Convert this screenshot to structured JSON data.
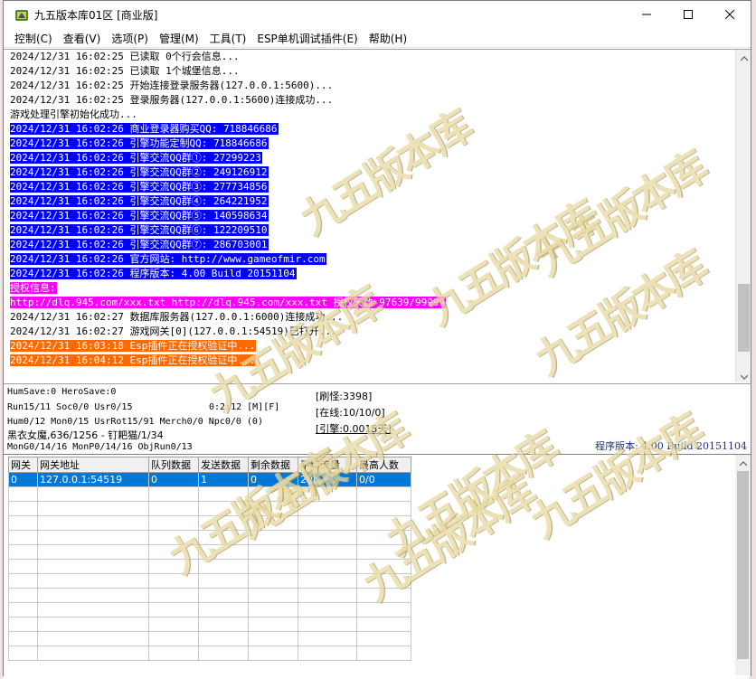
{
  "window": {
    "title": "九五版本库01区 [商业版]"
  },
  "menu": [
    "控制(C)",
    "查看(V)",
    "选项(P)",
    "管理(M)",
    "工具(T)",
    "ESP单机调试插件(E)",
    "帮助(H)"
  ],
  "log": [
    {
      "text": "2024/12/31 16:02:25 已读取 0个行会信息...",
      "style": "normal"
    },
    {
      "text": "2024/12/31 16:02:25 已读取 1个城堡信息...",
      "style": "normal"
    },
    {
      "text": "2024/12/31 16:02:25 开始连接登录服务器(127.0.0.1:5600)...",
      "style": "normal"
    },
    {
      "text": "2024/12/31 16:02:25 登录服务器(127.0.0.1:5600)连接成功...",
      "style": "normal"
    },
    {
      "text": "游戏处理引擎初始化成功...",
      "style": "normal"
    },
    {
      "text": "2024/12/31 16:02:26 商业登录器购买QQ: 718846686",
      "style": "blue"
    },
    {
      "text": "2024/12/31 16:02:26 引擎功能定制QQ: 718846686",
      "style": "blue"
    },
    {
      "text": "2024/12/31 16:02:26 引擎交流QQ群①: 27299223",
      "style": "blue"
    },
    {
      "text": "2024/12/31 16:02:26 引擎交流QQ群②: 249126912",
      "style": "blue"
    },
    {
      "text": "2024/12/31 16:02:26 引擎交流QQ群③: 277734856",
      "style": "blue"
    },
    {
      "text": "2024/12/31 16:02:26 引擎交流QQ群④: 264221952",
      "style": "blue"
    },
    {
      "text": "2024/12/31 16:02:26 引擎交流QQ群⑤: 140598634",
      "style": "blue"
    },
    {
      "text": "2024/12/31 16:02:26 引擎交流QQ群⑥: 122209510",
      "style": "blue"
    },
    {
      "text": "2024/12/31 16:02:26 引擎交流QQ群⑦: 286703001",
      "style": "blue"
    },
    {
      "text": "2024/12/31 16:02:26 官方网站: http://www.gameofmir.com",
      "style": "blue"
    },
    {
      "text": "2024/12/31 16:02:26 程序版本: 4.00 Build 20151104",
      "style": "blue"
    },
    {
      "text": "授权信息:",
      "style": "magenta"
    },
    {
      "text": "http://dlq.945.com/xxx.txt http://dlq.945.com/xxx.txt 授权天数 97639/99999",
      "style": "magenta"
    },
    {
      "text": "2024/12/31 16:02:27 数据库服务器(127.0.0.1:6000)连接成功...",
      "style": "normal"
    },
    {
      "text": "2024/12/31 16:02:27 游戏网关[0](127.0.0.1:54519)已打开...",
      "style": "normal"
    },
    {
      "text": "2024/12/31 16:03:18 Esp插件正在授权验证中...",
      "style": "orange"
    },
    {
      "text": "2024/12/31 16:04:12 Esp插件正在授权验证中...",
      "style": "orange"
    }
  ],
  "status": {
    "line1": "HumSave:0 HeroSave:0",
    "line2": "Run15/11 Soc0/0 Usr0/15",
    "time": "0:2:12 [M][F]",
    "line3": "Hum0/12 Mon0/15 UsrRot15/91 Merch0/0 Npc0/0 (0)",
    "line4": "黑衣女魔,636/1256 - 钉耙猫/1/34",
    "line5": "MonG0/14/16 MonP0/14/16 ObjRun0/13",
    "refresh": "[刷怪:3398]",
    "online": "[在线:10/10/0]",
    "engine": "[引擎:0.0015天]",
    "version": "程序版本: 4.00 Build 20151104"
  },
  "grid": {
    "columns": [
      "网关",
      "网关地址",
      "队列数据",
      "发送数据",
      "剩余数据",
      "平均流量",
      "最高人数"
    ],
    "rows": [
      [
        "0",
        "127.0.0.1:54519",
        "0",
        "1",
        "0",
        "20b",
        "0/0"
      ]
    ]
  },
  "watermark": "九五版本库",
  "icons": {
    "app": "app-icon",
    "minimize": "minimize-icon",
    "maximize": "maximize-icon",
    "close": "close-icon"
  },
  "colors": {
    "highlight_blue": "#0000ff",
    "highlight_magenta": "#ff00ff",
    "highlight_orange": "#ff6a00",
    "selection": "#0078d7",
    "version_text": "#1e2f8f"
  }
}
